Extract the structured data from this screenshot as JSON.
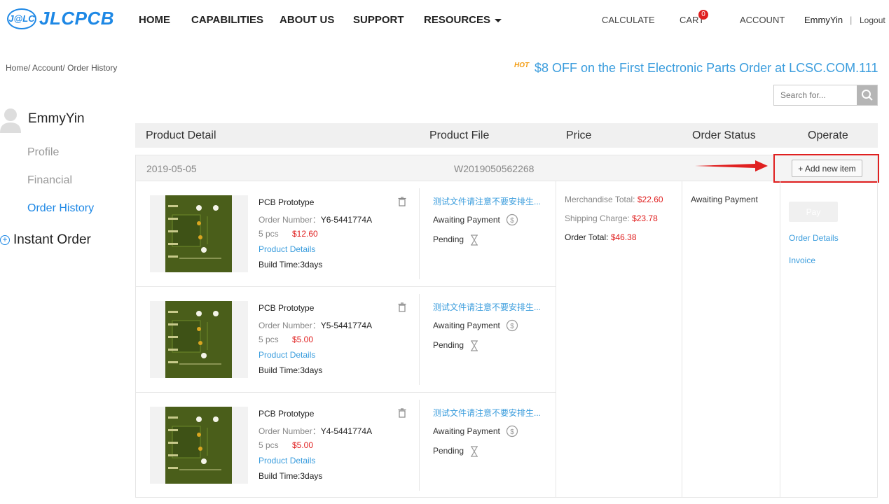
{
  "header": {
    "logo_mark": "J@LC",
    "logo_text": "JLCPCB",
    "nav": [
      "HOME",
      "CAPABILITIES",
      "ABOUT US",
      "SUPPORT",
      "RESOURCES"
    ],
    "right_links": {
      "calculate": "CALCULATE",
      "cart": "CART",
      "cart_count": "0",
      "account": "ACCOUNT",
      "user": "EmmyYin",
      "separator": "|",
      "logout": "Logout"
    }
  },
  "breadcrumb": {
    "home": "Home/",
    "account": "Account/",
    "current": "Order History"
  },
  "promo": {
    "badge": "HOT",
    "text": "$8 OFF on the First Electronic Parts Order at LCSC.COM.111"
  },
  "search": {
    "placeholder": "Search for..."
  },
  "sidebar": {
    "user_name": "EmmyYin",
    "items": [
      {
        "label": "Profile"
      },
      {
        "label": "Financial"
      },
      {
        "label": "Order History"
      }
    ],
    "instant_order": "Instant Order"
  },
  "table": {
    "headers": {
      "product_detail": "Product Detail",
      "product_file": "Product File",
      "price": "Price",
      "order_status": "Order Status",
      "operate": "Operate"
    }
  },
  "order": {
    "date": "2019-05-05",
    "number": "W2019050562268",
    "add_item": "+ Add new item",
    "items": [
      {
        "name": "PCB Prototype",
        "order_label": "Order Number：",
        "order_number": "Y6-5441774A",
        "qty": "5 pcs",
        "price": "$12.60",
        "details": "Product Details",
        "build": "Build Time:3days",
        "file": "测试文件请注意不要安排生...",
        "payment": "Awaiting Payment",
        "status": "Pending"
      },
      {
        "name": "PCB Prototype",
        "order_label": "Order Number：",
        "order_number": "Y5-5441774A",
        "qty": "5 pcs",
        "price": "$5.00",
        "details": "Product Details",
        "build": "Build Time:3days",
        "file": "测试文件请注意不要安排生...",
        "payment": "Awaiting Payment",
        "status": "Pending"
      },
      {
        "name": "PCB Prototype",
        "order_label": "Order Number：",
        "order_number": "Y4-5441774A",
        "qty": "5 pcs",
        "price": "$5.00",
        "details": "Product Details",
        "build": "Build Time:3days",
        "file": "测试文件请注意不要安排生...",
        "payment": "Awaiting Payment",
        "status": "Pending"
      }
    ],
    "price_summary": {
      "merchandise_label": "Merchandise Total:",
      "merchandise": "$22.60",
      "shipping_label": "Shipping Charge:",
      "shipping": "$23.78",
      "total_label": "Order Total:",
      "total": "$46.38"
    },
    "order_status": "Awaiting Payment",
    "operate": {
      "pay": "Pay",
      "details": "Order Details",
      "invoice": "Invoice"
    }
  },
  "colors": {
    "brand": "#1e88e5",
    "link": "#3b9ddd",
    "price": "#e02020",
    "annotation": "#e02020"
  }
}
